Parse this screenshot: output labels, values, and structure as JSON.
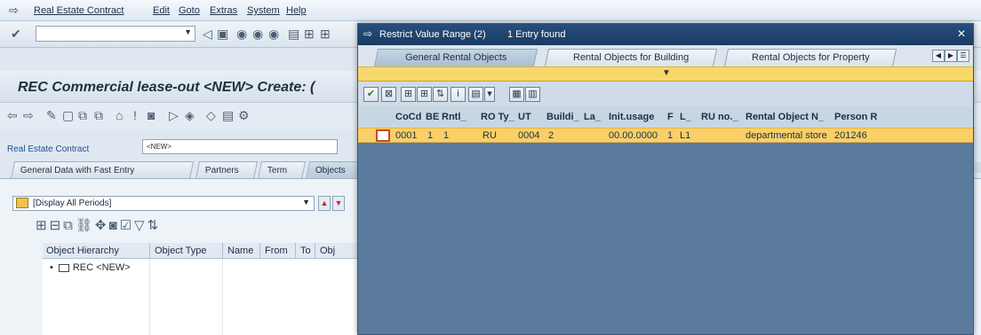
{
  "window": {
    "menu": [
      "Real Estate Contract",
      "Edit",
      "Goto",
      "Extras",
      "System",
      "Help"
    ],
    "title": "REC Commercial lease-out <NEW> Create: ("
  },
  "contract": {
    "label": "Real Estate Contract",
    "value": "<NEW>"
  },
  "tabs": [
    "General Data with Fast Entry",
    "Partners",
    "Term",
    "Objects"
  ],
  "periods_select": "[Display All Periods]",
  "tree": {
    "headers": [
      "Object Hierarchy",
      "Object Type",
      "Name",
      "From",
      "To",
      "Obj"
    ],
    "node": "REC <NEW>"
  },
  "popup": {
    "title": "Restrict Value Range (2)",
    "entries_found": "1 Entry found",
    "close_icon": "close-icon",
    "tabs": [
      "General Rental Objects",
      "Rental Objects for Building",
      "Rental Objects for Property"
    ],
    "active_tab": "General Rental Objects",
    "columns": [
      "CoCd",
      "BE",
      "Rntl_",
      "RO Ty_",
      "UT",
      "Buildi_",
      "La_",
      "Init.usage",
      "F",
      "L_",
      "RU no._",
      "Rental Object N_",
      "Person R"
    ],
    "rows": [
      [
        "0001",
        "1",
        "1",
        "RU",
        "0004",
        "2",
        "",
        "00.00.0000",
        "1",
        "L1",
        "",
        "departmental store",
        "201246"
      ]
    ]
  },
  "colors": {
    "popup_title": "#1f4470",
    "selected_row": "#f9cf68",
    "header_band": "#f8d86a"
  }
}
